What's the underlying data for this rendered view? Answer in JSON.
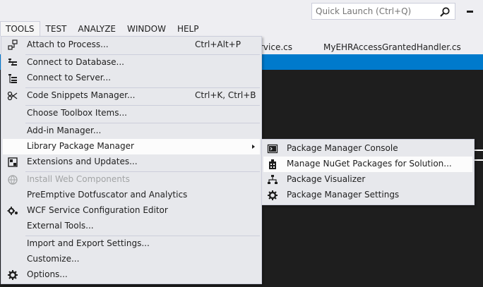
{
  "quick_launch": {
    "placeholder": "Quick Launch (Ctrl+Q)"
  },
  "menubar": [
    "TOOLS",
    "TEST",
    "ANALYZE",
    "WINDOW",
    "HELP"
  ],
  "tabs": [
    "rvice.cs",
    "MyEHRAccessGrantedHandler.cs"
  ],
  "tools_menu": {
    "items": [
      {
        "label": "Attach to Process...",
        "shortcut": "Ctrl+Alt+P",
        "icon": "attach-process-icon"
      },
      {
        "label": "Connect to Database...",
        "icon": "connect-database-icon"
      },
      {
        "label": "Connect to Server...",
        "icon": "connect-server-icon"
      },
      {
        "label": "Code Snippets Manager...",
        "shortcut": "Ctrl+K, Ctrl+B",
        "icon": "code-snippets-icon"
      },
      {
        "label": "Choose Toolbox Items..."
      },
      {
        "label": "Add-in Manager..."
      },
      {
        "label": "Library Package Manager"
      },
      {
        "label": "Extensions and Updates...",
        "icon": "extensions-icon"
      },
      {
        "label": "Install Web Components",
        "icon": "web-components-icon",
        "disabled": true
      },
      {
        "label": "PreEmptive Dotfuscator and Analytics"
      },
      {
        "label": "WCF Service Configuration Editor",
        "icon": "wcf-config-icon"
      },
      {
        "label": "External Tools..."
      },
      {
        "label": "Import and Export Settings..."
      },
      {
        "label": "Customize..."
      },
      {
        "label": "Options...",
        "icon": "gear-icon"
      }
    ]
  },
  "submenu": {
    "items": [
      {
        "label": "Package Manager Console",
        "icon": "console-icon"
      },
      {
        "label": "Manage NuGet Packages for Solution...",
        "icon": "nuget-package-icon"
      },
      {
        "label": "Package Visualizer",
        "icon": "visualizer-icon"
      },
      {
        "label": "Package Manager Settings",
        "icon": "gear-icon"
      }
    ]
  },
  "colors": {
    "menu_bg": "#e7e8ec",
    "highlight": "#fcfcfc",
    "accent": "#007acc",
    "editor_bg": "#1e1e1e",
    "disabled_text": "#a2a4a5"
  }
}
